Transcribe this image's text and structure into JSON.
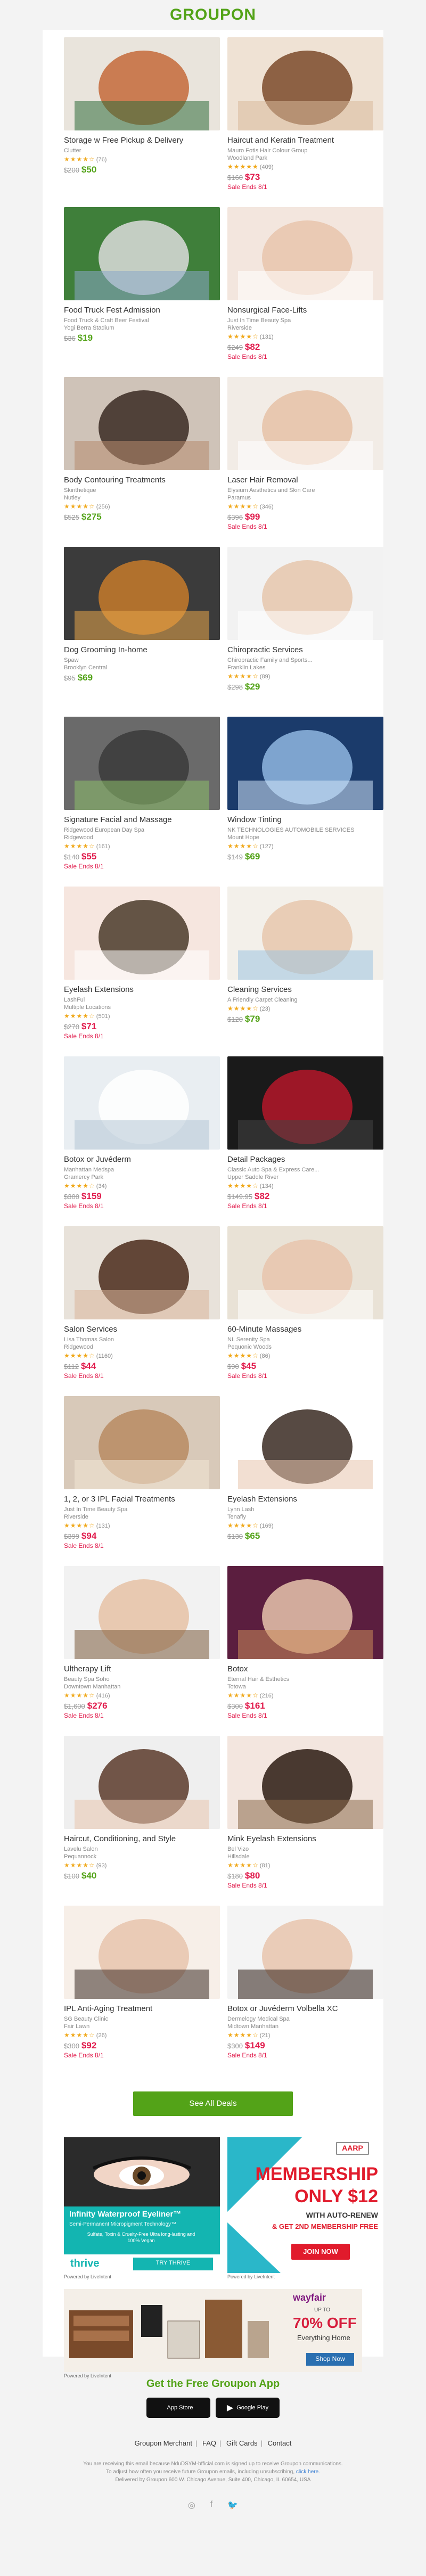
{
  "header": {
    "logo": "GROUPON"
  },
  "deals": [
    {
      "title": "Storage w Free Pickup & Delivery",
      "merchant": "Clutter",
      "location": "",
      "stars": "★★★★☆",
      "reviews": "(76)",
      "orig": "$200",
      "sale": "$50",
      "sale_color": "green",
      "ends": "",
      "icon": "storage-photo"
    },
    {
      "title": "Haircut and Keratin Treatment",
      "merchant": "Mauro Fotis Hair Colour Group",
      "location": "Woodland Park",
      "stars": "★★★★★",
      "reviews": "(409)",
      "orig": "$160",
      "sale": "$73",
      "sale_color": "red",
      "ends": "Sale Ends 8/1",
      "icon": "hair-photo"
    },
    {
      "title": "Food Truck Fest Admission",
      "merchant": "Food Truck & Craft Beer Festival",
      "location": "Yogi Berra Stadium",
      "stars": "",
      "reviews": "",
      "orig": "$36",
      "sale": "$19",
      "sale_color": "green",
      "ends": "",
      "icon": "stadium-photo"
    },
    {
      "title": "Nonsurgical Face-Lifts",
      "merchant": "Just In Time Beauty Spa",
      "location": "Riverside",
      "stars": "★★★★☆",
      "reviews": "(131)",
      "orig": "$249",
      "sale": "$82",
      "sale_color": "red",
      "ends": "Sale Ends 8/1",
      "icon": "facial-photo"
    },
    {
      "title": "Body Contouring Treatments",
      "merchant": "Skinthetique",
      "location": "Nutley",
      "stars": "★★★★☆",
      "reviews": "(256)",
      "orig": "$525",
      "sale": "$275",
      "sale_color": "green",
      "ends": "",
      "icon": "body-photo"
    },
    {
      "title": "Laser Hair Removal",
      "merchant": "Elysium Aesthetics and Skin Care",
      "location": "Paramus",
      "stars": "★★★★☆",
      "reviews": "(346)",
      "orig": "$396",
      "sale": "$99",
      "sale_color": "red",
      "ends": "Sale Ends 8/1",
      "icon": "legs-photo"
    },
    {
      "title": "Dog Grooming In-home",
      "merchant": "Spaw",
      "location": "Brooklyn Central",
      "stars": "",
      "reviews": "",
      "orig": "$95",
      "sale": "$69",
      "sale_color": "green",
      "ends": "",
      "icon": "dog-photo"
    },
    {
      "title": "Chiropractic Services",
      "merchant": "Chiropractic Family and Sports...",
      "location": "Franklin Lakes",
      "stars": "★★★★☆",
      "reviews": "(89)",
      "orig": "$298",
      "sale": "$29",
      "sale_color": "green",
      "ends": "",
      "icon": "chiro-photo"
    },
    {
      "title": "Signature Facial and Massage",
      "merchant": "Ridgewood European Day Spa",
      "location": "Ridgewood",
      "stars": "★★★★☆",
      "reviews": "(161)",
      "orig": "$140",
      "sale": "$55",
      "sale_color": "red",
      "ends": "Sale Ends 8/1",
      "icon": "dayspa-photo"
    },
    {
      "title": "Window Tinting",
      "merchant": "NK TECHNOLOGIES AUTOMOBILE SERVICES",
      "location": "Mount Hope",
      "stars": "★★★★☆",
      "reviews": "(127)",
      "orig": "$149",
      "sale": "$69",
      "sale_color": "green",
      "ends": "",
      "icon": "car-photo"
    },
    {
      "title": "Eyelash Extensions",
      "merchant": "LashFul",
      "location": "Multiple Locations",
      "stars": "★★★★☆",
      "reviews": "(501)",
      "orig": "$270",
      "sale": "$71",
      "sale_color": "red",
      "ends": "Sale Ends 8/1",
      "icon": "eye-photo"
    },
    {
      "title": "Cleaning Services",
      "merchant": "A Friendly Carpet Cleaning",
      "location": "",
      "stars": "★★★★☆",
      "reviews": "(23)",
      "orig": "$120",
      "sale": "$79",
      "sale_color": "green",
      "ends": "",
      "icon": "family-photo"
    },
    {
      "title": "Botox or Juvéderm",
      "merchant": "Manhattan Medspa",
      "location": "Gramercy Park",
      "stars": "★★★★☆",
      "reviews": "(34)",
      "orig": "$300",
      "sale": "$159",
      "sale_color": "red",
      "ends": "Sale Ends 8/1",
      "icon": "clinic-photo"
    },
    {
      "title": "Detail Packages",
      "merchant": "Classic Auto Spa & Express Care...",
      "location": "Upper Saddle River",
      "stars": "★★★★☆",
      "reviews": "(134)",
      "orig": "$149.95",
      "sale": "$82",
      "sale_color": "red",
      "ends": "Sale Ends 8/1",
      "icon": "car-interior-photo"
    },
    {
      "title": "Salon Services",
      "merchant": "Lisa Thomas Salon",
      "location": "Ridgewood",
      "stars": "★★★★☆",
      "reviews": "(1160)",
      "orig": "$112",
      "sale": "$44",
      "sale_color": "red",
      "ends": "Sale Ends 8/1",
      "icon": "salon-photo"
    },
    {
      "title": "60-Minute Massages",
      "merchant": "NL Serenity Spa",
      "location": "Pequonic Woods",
      "stars": "★★★★☆",
      "reviews": "(86)",
      "orig": "$90",
      "sale": "$45",
      "sale_color": "red",
      "ends": "Sale Ends 8/1",
      "icon": "massage-photo"
    },
    {
      "title": "1, 2, or 3 IPL Facial Treatments",
      "merchant": "Just In Time Beauty Spa",
      "location": "Riverside",
      "stars": "★★★★☆",
      "reviews": "(131)",
      "orig": "$399",
      "sale": "$94",
      "sale_color": "red",
      "ends": "Sale Ends 8/1",
      "icon": "ipl-photo"
    },
    {
      "title": "Eyelash Extensions",
      "merchant": "Lynn Lash",
      "location": "Tenafly",
      "stars": "★★★★☆",
      "reviews": "(169)",
      "orig": "$130",
      "sale": "$65",
      "sale_color": "green",
      "ends": "",
      "icon": "lash-woman-photo"
    },
    {
      "title": "Ultherapy Lift",
      "merchant": "Beauty Spa Soho",
      "location": "Downtown Manhattan",
      "stars": "★★★★☆",
      "reviews": "(416)",
      "orig": "$1,600",
      "sale": "$276",
      "sale_color": "red",
      "ends": "Sale Ends 8/1",
      "icon": "couple-photo"
    },
    {
      "title": "Botox",
      "merchant": "Eternal Hair & Esthetics",
      "location": "Totowa",
      "stars": "★★★★☆",
      "reviews": "(216)",
      "orig": "$300",
      "sale": "$161",
      "sale_color": "red",
      "ends": "Sale Ends 8/1",
      "icon": "botox-photo"
    },
    {
      "title": "Haircut, Conditioning, and Style",
      "merchant": "Lavelu Salon",
      "location": "Pequannock",
      "stars": "★★★★☆",
      "reviews": "(93)",
      "orig": "$100",
      "sale": "$40",
      "sale_color": "green",
      "ends": "",
      "icon": "haircut-photo"
    },
    {
      "title": "Mink Eyelash Extensions",
      "merchant": "Bel Vizo",
      "location": "Hillsdale",
      "stars": "★★★★☆",
      "reviews": "(81)",
      "orig": "$180",
      "sale": "$80",
      "sale_color": "red",
      "ends": "Sale Ends 8/1",
      "icon": "mink-lash-photo"
    },
    {
      "title": "IPL Anti-Aging Treatment",
      "merchant": "SG Beauty Clinic",
      "location": "Fair Lawn",
      "stars": "★★★★☆",
      "reviews": "(26)",
      "orig": "$300",
      "sale": "$92",
      "sale_color": "red",
      "ends": "Sale Ends 8/1",
      "icon": "antiaging-photo"
    },
    {
      "title": "Botox or Juvéderm Volbella XC",
      "merchant": "Dermelogy Medical Spa",
      "location": "Midtown Manhattan",
      "stars": "★★★★☆",
      "reviews": "(21)",
      "orig": "$300",
      "sale": "$149",
      "sale_color": "red",
      "ends": "Sale Ends 8/1",
      "icon": "volbella-photo"
    }
  ],
  "see_all": "See All Deals",
  "ads": {
    "left": {
      "headline": "Infinity Waterproof Eyeliner™",
      "sub": "Semi-Permanent Micropigment Technology™",
      "bullets": "Sulfate, Toxin & Cruelty-Free Ultra long-lasting and 100% Vegan",
      "brand": "thrive",
      "cta": "TRY THRIVE",
      "powered": "Powered by LiveIntent"
    },
    "right": {
      "brand": "AARP",
      "line1": "MEMBERSHIP",
      "line2": "ONLY $12",
      "line3": "WITH AUTO-RENEW",
      "line4": "& GET 2ND MEMBERSHIP FREE",
      "cta": "JOIN NOW",
      "powered": "Powered by LiveIntent"
    },
    "wide": {
      "brand": "wayfair",
      "upto": "UP TO",
      "pct": "70% OFF",
      "sub": "Everything Home",
      "cta": "Shop Now",
      "powered": "Powered by LiveIntent"
    }
  },
  "footer": {
    "app_title": "Get the Free Groupon App",
    "app_store": "App Store",
    "google_play": "Google Play",
    "links": [
      "Groupon Merchant",
      "FAQ",
      "Gift Cards",
      "Contact"
    ],
    "legal1": "You are receiving this email because NduDSYM-bfficial.com is signed up to receive Groupon communications.",
    "legal2": "To adjust how often you receive future Groupon emails, including unsubscribing,",
    "legal2_link": "click here.",
    "legal3": "Delivered by Groupon 600 W. Chicago Avenue, Suite 400, Chicago, IL 60654, USA",
    "social": [
      "instagram-icon",
      "facebook-icon",
      "twitter-icon"
    ]
  },
  "colors": {
    "brand": "#53a318",
    "sale_red": "#e11b4c",
    "star": "#f0a81a"
  }
}
